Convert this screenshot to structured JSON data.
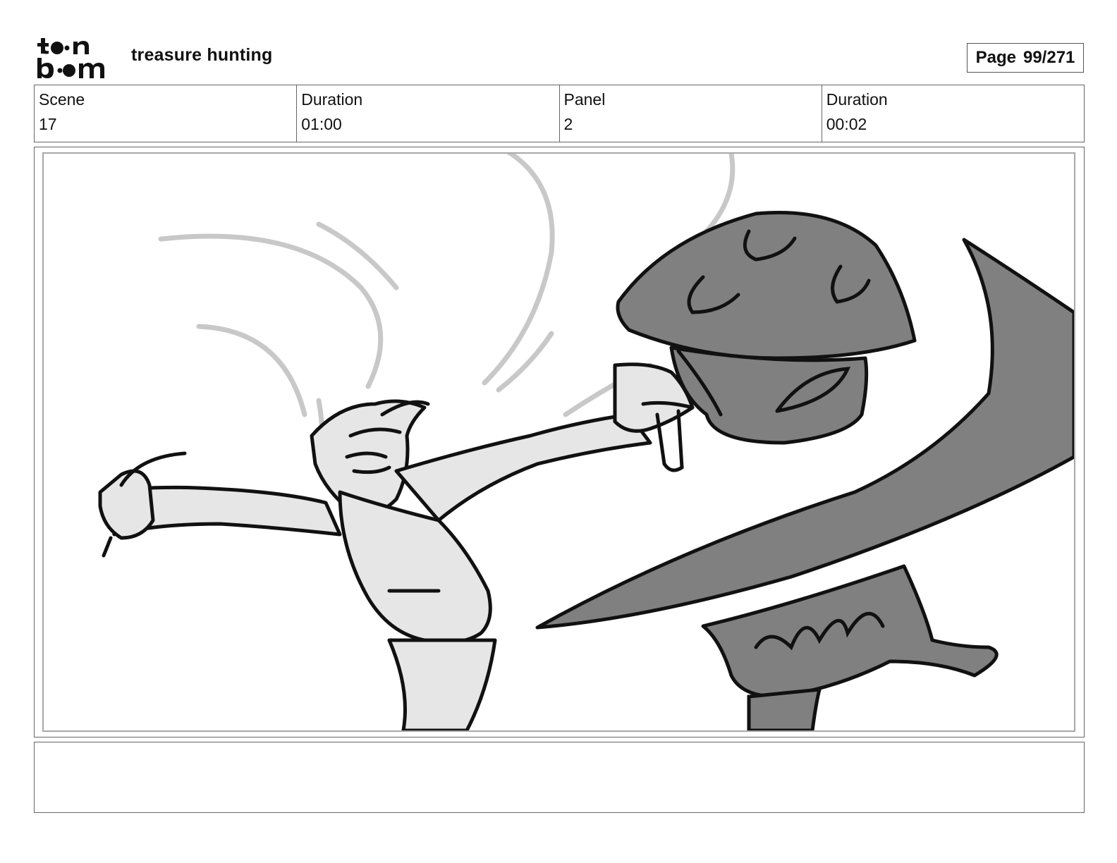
{
  "header": {
    "logo_text": "toon boom",
    "project_title": "treasure hunting",
    "page_label": "Page",
    "page_value": "99/271"
  },
  "info": [
    {
      "label": "Scene",
      "value": "17"
    },
    {
      "label": "Duration",
      "value": "01:00"
    },
    {
      "label": "Panel",
      "value": "2"
    },
    {
      "label": "Duration",
      "value": "00:02"
    }
  ],
  "notes": {
    "text": ""
  },
  "colors": {
    "sketch_fill_light": "#e6e6e6",
    "sketch_fill_dark": "#808080",
    "motion_lines": "#c8c8c8"
  }
}
